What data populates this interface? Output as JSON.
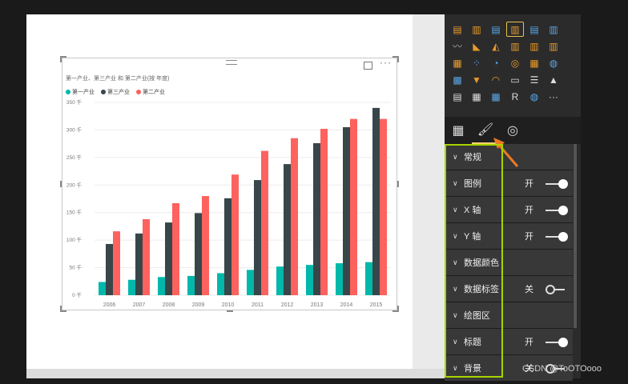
{
  "visual": {
    "title": "第一产业、第三产业 和 第二产业(按 年度)",
    "more_label": "···"
  },
  "chart_data": {
    "type": "bar",
    "title": "第一产业、第三产业 和 第二产业(按 年度)",
    "categories": [
      "2006",
      "2007",
      "2008",
      "2009",
      "2010",
      "2011",
      "2012",
      "2013",
      "2014",
      "2015"
    ],
    "series": [
      {
        "name": "第一产业",
        "color": "#01b8aa",
        "values": [
          24,
          28,
          33,
          35,
          40,
          46,
          52,
          55,
          58,
          60
        ]
      },
      {
        "name": "第三产业",
        "color": "#374649",
        "values": [
          93,
          112,
          132,
          149,
          176,
          209,
          238,
          276,
          305,
          340
        ]
      },
      {
        "name": "第二产业",
        "color": "#fd625e",
        "values": [
          116,
          138,
          167,
          180,
          219,
          262,
          285,
          302,
          320,
          320
        ]
      }
    ],
    "ylim": [
      0,
      350
    ],
    "yticks": [
      "0 千",
      "50 千",
      "100 千",
      "150 千",
      "200 千",
      "250 千",
      "300 千",
      "350 千"
    ],
    "grid": true,
    "legend": "top-left"
  },
  "viz_gallery": {
    "rows": [
      [
        {
          "icon": "stacked-bar-icon",
          "glyph": "▤",
          "color": "#e89b2d"
        },
        {
          "icon": "stacked-column-icon",
          "glyph": "▥",
          "color": "#e89b2d"
        },
        {
          "icon": "clustered-bar-icon",
          "glyph": "▤",
          "color": "#5aa6e6"
        },
        {
          "icon": "clustered-column-icon",
          "glyph": "▥",
          "color": "#e89b2d",
          "selected": true
        },
        {
          "icon": "100-bar-icon",
          "glyph": "▤",
          "color": "#5aa6e6"
        },
        {
          "icon": "100-column-icon",
          "glyph": "▥",
          "color": "#5aa6e6"
        }
      ],
      [
        {
          "icon": "line-chart-icon",
          "glyph": "〰",
          "color": "#aaaaaa"
        },
        {
          "icon": "area-chart-icon",
          "glyph": "◣",
          "color": "#e89b2d"
        },
        {
          "icon": "stacked-area-icon",
          "glyph": "◭",
          "color": "#e89b2d"
        },
        {
          "icon": "line-column-icon",
          "glyph": "▥",
          "color": "#e89b2d"
        },
        {
          "icon": "line-stacked-column-icon",
          "glyph": "▥",
          "color": "#e89b2d"
        },
        {
          "icon": "ribbon-chart-icon",
          "glyph": "▥",
          "color": "#e89b2d"
        }
      ],
      [
        {
          "icon": "waterfall-icon",
          "glyph": "▦",
          "color": "#e89b2d"
        },
        {
          "icon": "scatter-icon",
          "glyph": "⁘",
          "color": "#5aa6e6"
        },
        {
          "icon": "pie-chart-icon",
          "glyph": "◔",
          "color": "#5aa6e6"
        },
        {
          "icon": "donut-chart-icon",
          "glyph": "◎",
          "color": "#e89b2d"
        },
        {
          "icon": "treemap-icon",
          "glyph": "▦",
          "color": "#e89b2d"
        },
        {
          "icon": "map-icon",
          "glyph": "◍",
          "color": "#5aa6e6"
        }
      ],
      [
        {
          "icon": "filled-map-icon",
          "glyph": "▩",
          "color": "#5aa6e6"
        },
        {
          "icon": "funnel-icon",
          "glyph": "▼",
          "color": "#e89b2d"
        },
        {
          "icon": "gauge-icon",
          "glyph": "◠",
          "color": "#e89b2d"
        },
        {
          "icon": "card-icon",
          "glyph": "▭",
          "color": "#dddddd"
        },
        {
          "icon": "multi-row-card-icon",
          "glyph": "☰",
          "color": "#dddddd"
        },
        {
          "icon": "kpi-icon",
          "glyph": "▲",
          "color": "#dddddd"
        }
      ],
      [
        {
          "icon": "slicer-icon",
          "glyph": "▤",
          "color": "#dddddd"
        },
        {
          "icon": "table-icon",
          "glyph": "▦",
          "color": "#dddddd"
        },
        {
          "icon": "matrix-icon",
          "glyph": "▦",
          "color": "#5aa6e6"
        },
        {
          "icon": "r-visual-icon",
          "glyph": "R",
          "color": "#dddddd"
        },
        {
          "icon": "globe-icon",
          "glyph": "◍",
          "color": "#5aa6e6"
        },
        {
          "icon": "more-visuals-icon",
          "glyph": "···",
          "color": "#dddddd"
        }
      ]
    ]
  },
  "pane_tabs": {
    "fields": "▦",
    "format": "🖌",
    "analytics": "◎"
  },
  "sections": [
    {
      "label": "常规",
      "state": "",
      "toggle": ""
    },
    {
      "label": "图例",
      "state": "开",
      "toggle": "on"
    },
    {
      "label": "X 轴",
      "state": "开",
      "toggle": "on"
    },
    {
      "label": "Y 轴",
      "state": "开",
      "toggle": "on"
    },
    {
      "label": "数据颜色",
      "state": "",
      "toggle": ""
    },
    {
      "label": "数据标签",
      "state": "关",
      "toggle": "off"
    },
    {
      "label": "绘图区",
      "state": "",
      "toggle": ""
    },
    {
      "label": "标题",
      "state": "开",
      "toggle": "on"
    },
    {
      "label": "背景",
      "state": "关",
      "toggle": "off"
    }
  ],
  "watermark": "CSDN @ToOTOooo"
}
